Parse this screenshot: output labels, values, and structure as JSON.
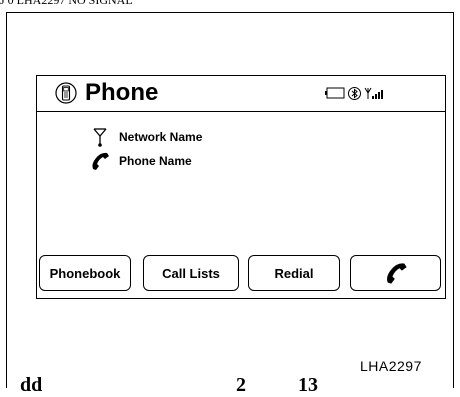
{
  "top_cut_text": "J 0  LHA2297  NO SIGNAL",
  "screen": {
    "title": "Phone",
    "status_icons": [
      "battery-icon",
      "bluetooth-icon",
      "signal-bars-icon"
    ],
    "network_name": "Network Name",
    "phone_name": "Phone Name"
  },
  "buttons": {
    "phonebook": "Phonebook",
    "call_lists": "Call Lists",
    "redial": "Redial",
    "call_icon": "handset-icon"
  },
  "figure_code": "LHA2297",
  "bottom_cut": [
    "dd",
    "2",
    "13"
  ]
}
